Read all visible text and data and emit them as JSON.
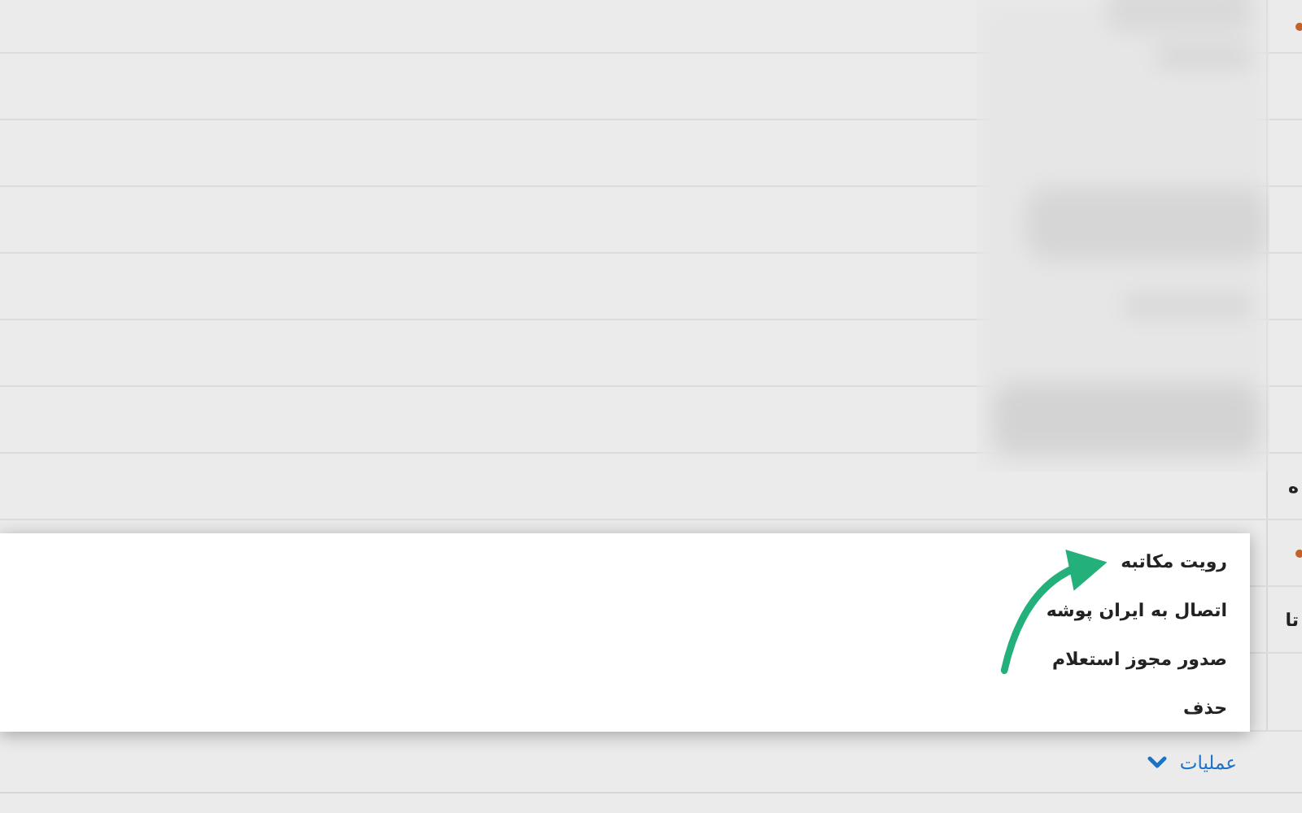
{
  "menu": {
    "items": [
      {
        "label": "رویت مکاتبه"
      },
      {
        "label": "اتصال به ایران پوشه"
      },
      {
        "label": "صدور مجوز استعلام"
      },
      {
        "label": "حذف"
      }
    ]
  },
  "actions_link": {
    "label": "عملیات"
  },
  "edge_texts": [
    "ه",
    "تا"
  ]
}
